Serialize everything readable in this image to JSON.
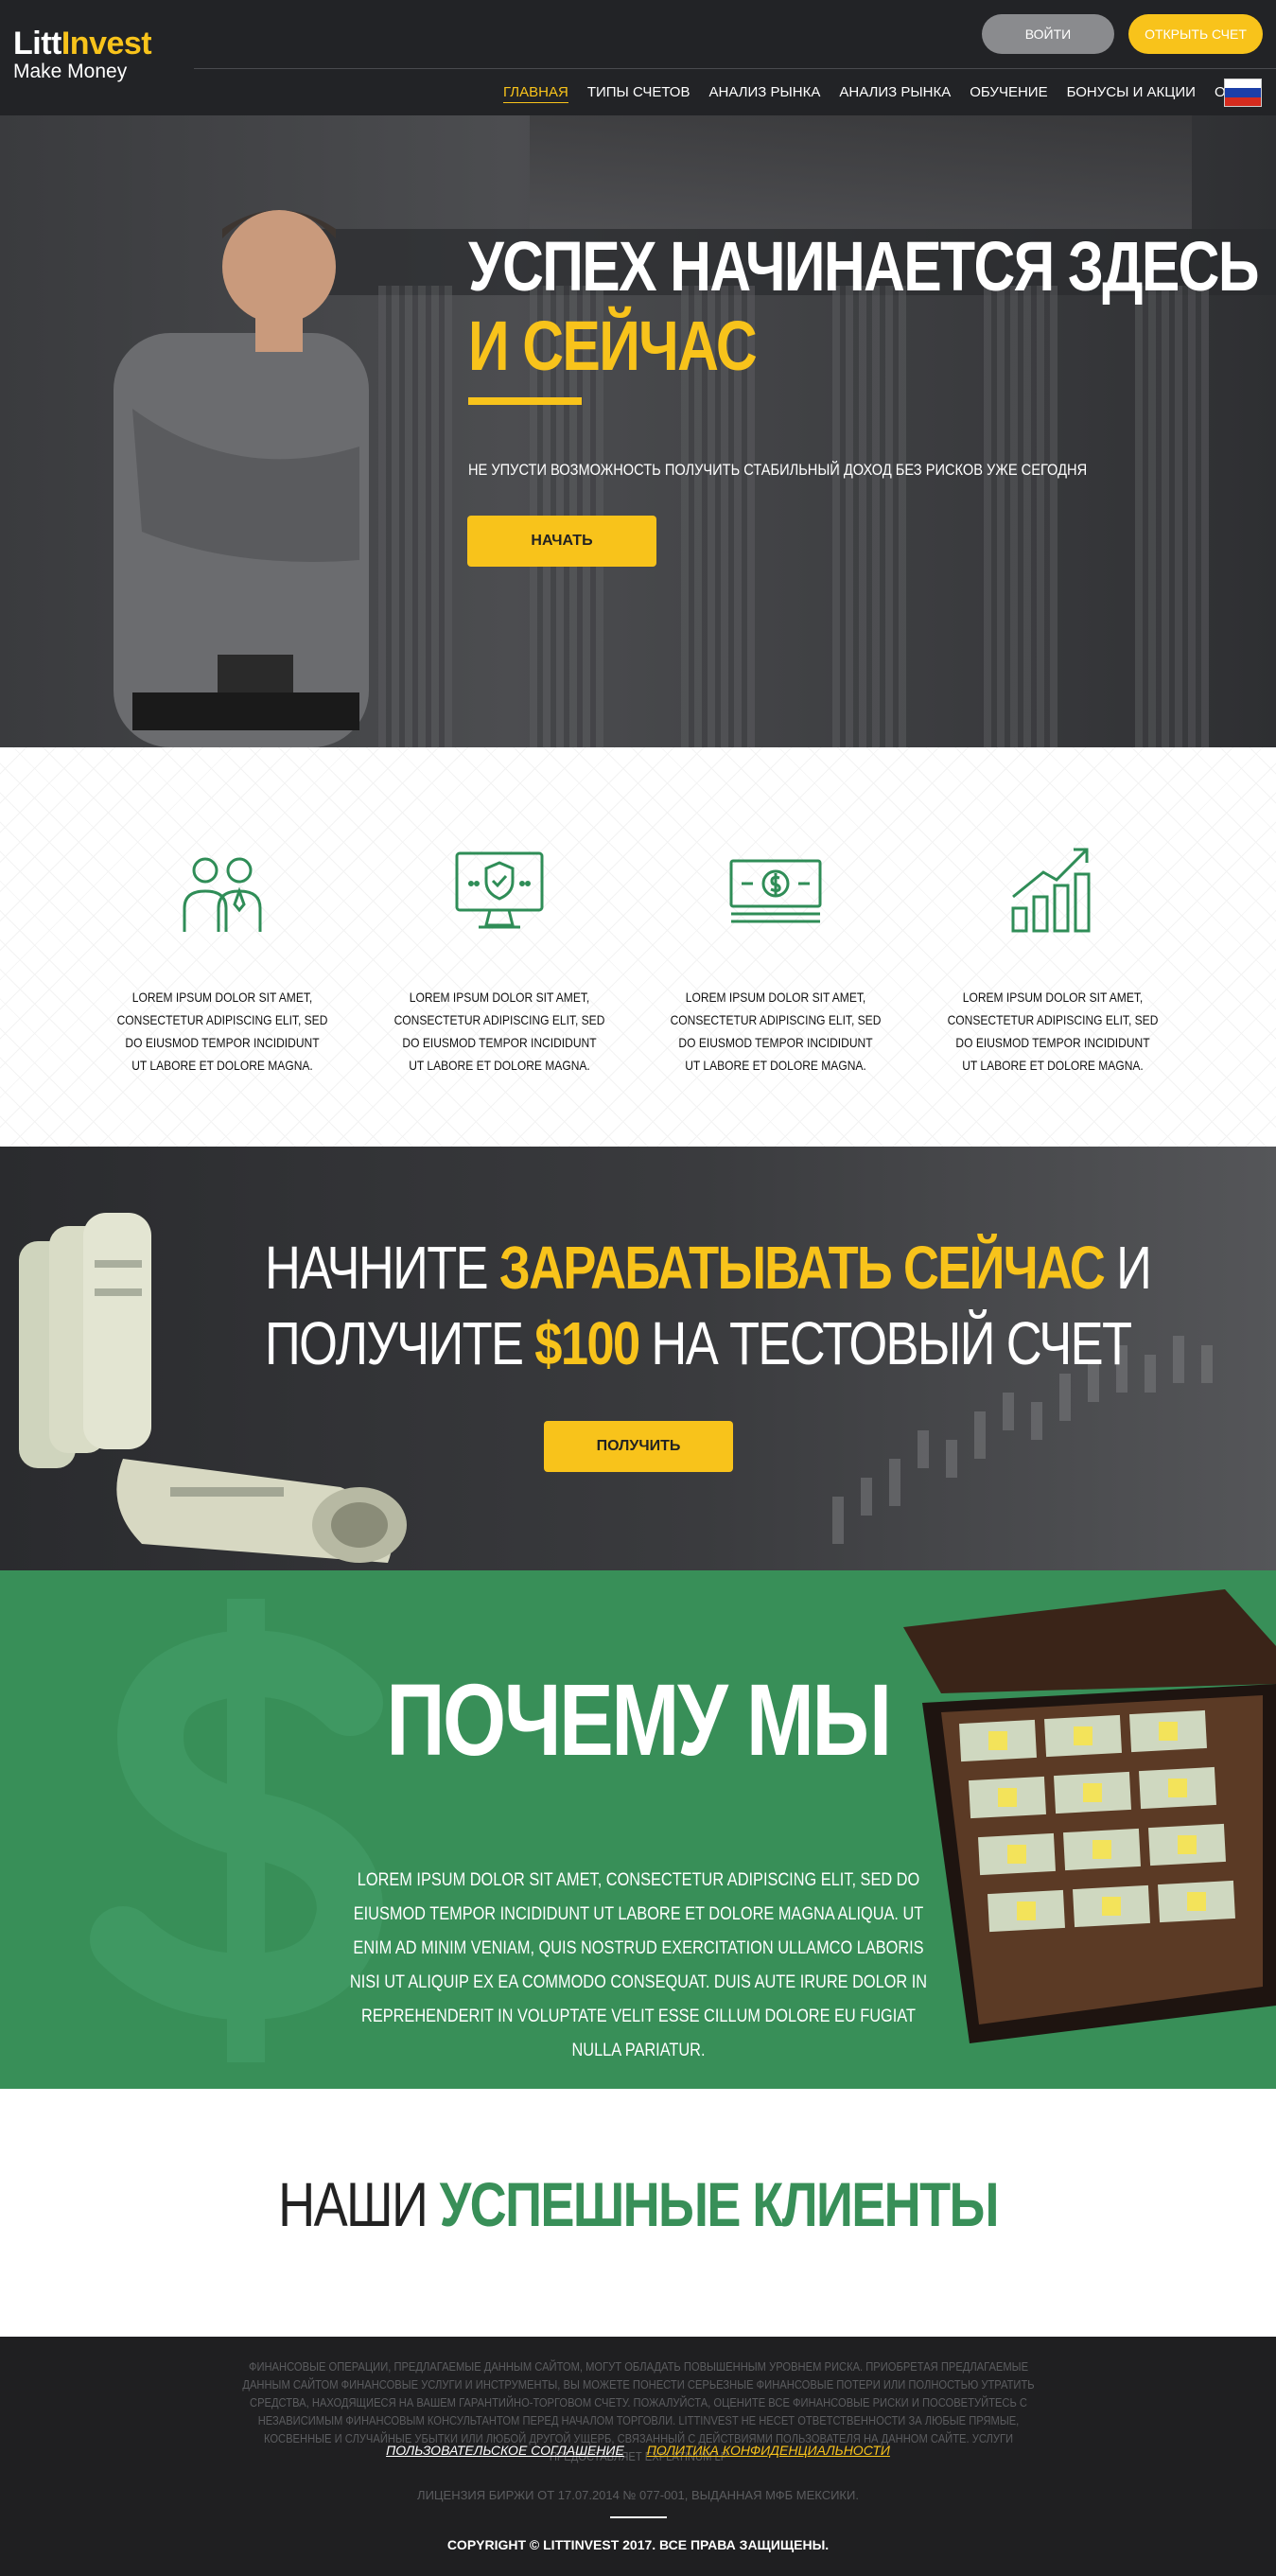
{
  "header": {
    "logo_part1": "Litt",
    "logo_part2": "Invest",
    "logo_tagline": "Make Money",
    "login_label": "ВОЙТИ",
    "open_account_label": "ОТКРЫТЬ СЧЕТ",
    "nav": [
      {
        "label": "ГЛАВНАЯ",
        "active": true
      },
      {
        "label": "ТИПЫ СЧЕТОВ",
        "active": false
      },
      {
        "label": "АНАЛИЗ РЫНКА",
        "active": false
      },
      {
        "label": "АНАЛИЗ РЫНКА",
        "active": false
      },
      {
        "label": "ОБУЧЕНИЕ",
        "active": false
      },
      {
        "label": "БОНУСЫ И АКЦИИ",
        "active": false
      },
      {
        "label": "О НАС",
        "active": false
      }
    ],
    "flag_icon": "russia-flag-icon"
  },
  "hero": {
    "title_line1": "УСПЕХ НАЧИНАЕТСЯ ЗДЕСЬ",
    "title_line2": "И СЕЙЧАС",
    "subtitle": "НЕ УПУСТИ ВОЗМОЖНОСТЬ ПОЛУЧИТЬ СТАБИЛЬНЫЙ ДОХОД БЕЗ РИСКОВ УЖЕ СЕГОДНЯ",
    "button_label": "НАЧАТЬ"
  },
  "features": [
    {
      "icon": "people-icon",
      "text": "LOREM IPSUM DOLOR SIT AMET, CONSECTETUR ADIPISCING ELIT, SED DO EIUSMOD TEMPOR INCIDIDUNT UT LABORE ET DOLORE MAGNA."
    },
    {
      "icon": "secure-monitor-icon",
      "text": "LOREM IPSUM DOLOR SIT AMET, CONSECTETUR ADIPISCING ELIT, SED DO EIUSMOD TEMPOR INCIDIDUNT UT LABORE ET DOLORE MAGNA."
    },
    {
      "icon": "money-icon",
      "text": "LOREM IPSUM DOLOR SIT AMET, CONSECTETUR ADIPISCING ELIT, SED DO EIUSMOD TEMPOR INCIDIDUNT UT LABORE ET DOLORE MAGNA."
    },
    {
      "icon": "growth-chart-icon",
      "text": "LOREM IPSUM DOLOR SIT AMET, CONSECTETUR ADIPISCING ELIT, SED DO EIUSMOD TEMPOR INCIDIDUNT UT LABORE ET DOLORE MAGNA."
    }
  ],
  "promo": {
    "line1_a": "НАЧНИТЕ ",
    "line1_b": "ЗАРАБАТЫВАТЬ СЕЙЧАС",
    "line1_c": " И",
    "line2_a": "ПОЛУЧИТЕ ",
    "line2_b": "$100",
    "line2_c": " НА ТЕСТОВЫЙ СЧЕТ",
    "button_label": "ПОЛУЧИТЬ"
  },
  "why": {
    "title": "ПОЧЕМУ МЫ",
    "text": "LOREM IPSUM DOLOR SIT AMET, CONSECTETUR ADIPISCING ELIT, SED DO EIUSMOD TEMPOR INCIDIDUNT UT LABORE ET DOLORE MAGNA ALIQUA. UT ENIM AD MINIM VENIAM, QUIS NOSTRUD EXERCITATION ULLAMCO LABORIS NISI UT ALIQUIP EX EA COMMODO CONSEQUAT. DUIS AUTE IRURE DOLOR IN REPREHENDERIT IN VOLUPTATE VELIT ESSE CILLUM DOLORE EU FUGIAT NULLA PARIATUR."
  },
  "clients": {
    "title_a": "НАШИ ",
    "title_b": "УСПЕШНЫЕ КЛИЕНТЫ"
  },
  "footer": {
    "disclaimer": "ФИНАНСОВЫЕ ОПЕРАЦИИ, ПРЕДЛАГАЕМЫЕ ДАННЫМ САЙТОМ, МОГУТ ОБЛАДАТЬ ПОВЫШЕННЫМ УРОВНЕМ РИСКА. ПРИОБРЕТАЯ ПРЕДЛАГАЕМЫЕ ДАННЫМ САЙТОМ ФИНАНСОВЫЕ УСЛУГИ И ИНСТРУМЕНТЫ, ВЫ МОЖЕТЕ ПОНЕСТИ СЕРЬЕЗНЫЕ ФИНАНСОВЫЕ ПОТЕРИ ИЛИ ПОЛНОСТЬЮ УТРАТИТЬ СРЕДСТВА, НАХОДЯЩИЕСЯ НА ВАШЕМ ГАРАНТИЙНО-ТОРГОВОМ СЧЕТУ. ПОЖАЛУЙСТА, ОЦЕНИТЕ ВСЕ ФИНАНСОВЫЕ РИСКИ И ПОСОВЕТУЙТЕСЬ С НЕЗАВИСИМЫМ ФИНАНСОВЫМ КОНСУЛЬТАНТОМ ПЕРЕД НАЧАЛОМ ТОРГОВЛИ. LITTINVEST НЕ НЕСЕТ ОТВЕТСТВЕННОСТИ ЗА ЛЮБЫЕ ПРЯМЫЕ, КОСВЕННЫЕ И СЛУЧАЙНЫЕ УБЫТКИ ИЛИ ЛЮБОЙ ДРУГОЙ УЩЕРБ, СВЯЗАННЫЙ С ДЕЙСТВИЯМИ ПОЛЬЗОВАТЕЛЯ НА ДАННОМ САЙТЕ. УСЛУГИ ПРЕДОСТАВЛЯЕТ EXPLATINUM LP",
    "link_agreement": "ПОЛЬЗОВАТЕЛЬСКОЕ СОГЛАШЕНИЕ",
    "link_privacy": "ПОЛИТИКА КОНФИДЕНЦИАЛЬНОСТИ",
    "license": "ЛИЦЕНЗИЯ БИРЖИ ОТ 17.07.2014 № 077-001, ВЫДАННАЯ МФБ МЕКСИКИ.",
    "copyright": "COPYRIGHT © LITTINVEST 2017. ВСЕ ПРАВА ЗАЩИЩЕНЫ."
  },
  "colors": {
    "accent_yellow": "#f8c31b",
    "brand_green": "#388f58",
    "header_dark": "#222326",
    "footer_dark": "#1f1f21"
  }
}
